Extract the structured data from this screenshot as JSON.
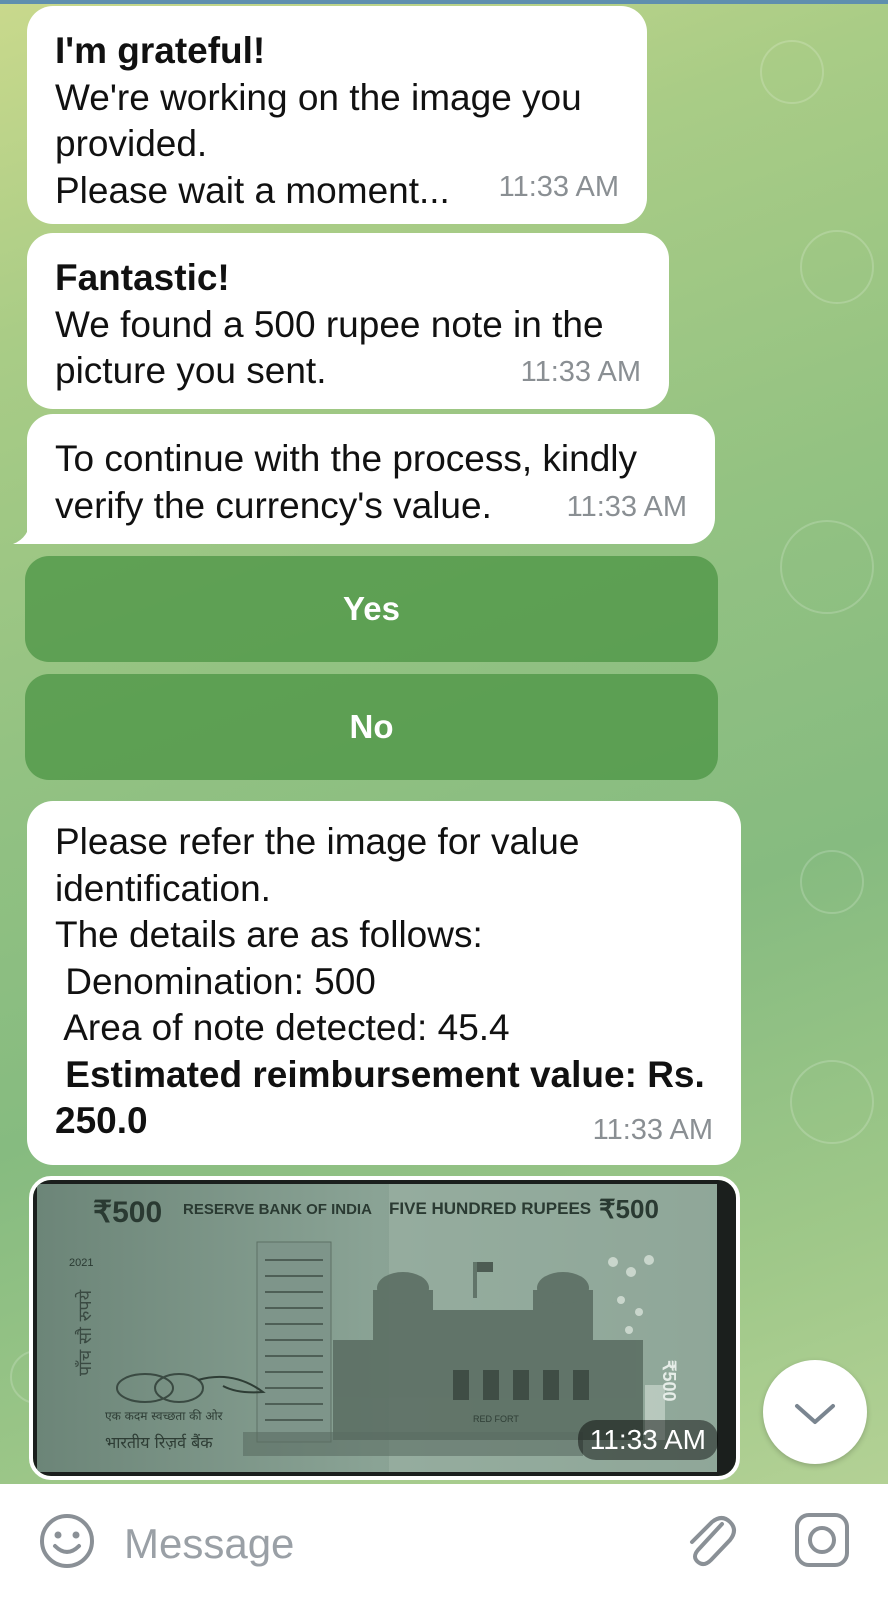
{
  "messages": [
    {
      "lines": [
        "I'm grateful!",
        "We're working on the image you",
        "provided.",
        "Please wait a moment..."
      ],
      "time": "11:33 AM"
    },
    {
      "lines": [
        "Fantastic!",
        "We found a 500 rupee note in the",
        "picture you sent."
      ],
      "time": "11:33 AM"
    },
    {
      "lines": [
        "To continue with the process, kindly",
        "verify the currency's value."
      ],
      "time": "11:33 AM"
    },
    {
      "lines": [
        "Please refer the image for value",
        "identification.",
        "The details are as follows:",
        " Denomination: 500",
        " Area of note detected: 45.4",
        " Estimated reimbursement value: Rs.",
        "250.0"
      ],
      "time": "11:33 AM"
    }
  ],
  "keyboard": {
    "yes": "Yes",
    "no": "No"
  },
  "photo": {
    "time": "11:33 AM",
    "note_text": {
      "value": "₹500",
      "bank": "RESERVE BANK OF INDIA",
      "words": "FIVE HUNDRED RUPEES",
      "value_right": "₹500",
      "year": "2021",
      "hindi_side": "पाँच सौ रुपये",
      "hindi_bank": "भारतीय रिज़र्व बैंक",
      "slogan": "एक कदम स्वच्छता की ओर",
      "red_fort": "RED FORT"
    }
  },
  "input": {
    "placeholder": "Message"
  },
  "icons": {
    "emoji": "emoji-icon",
    "attach": "paperclip-icon",
    "camera": "camera-icon",
    "scroll": "chevron-down-icon"
  }
}
